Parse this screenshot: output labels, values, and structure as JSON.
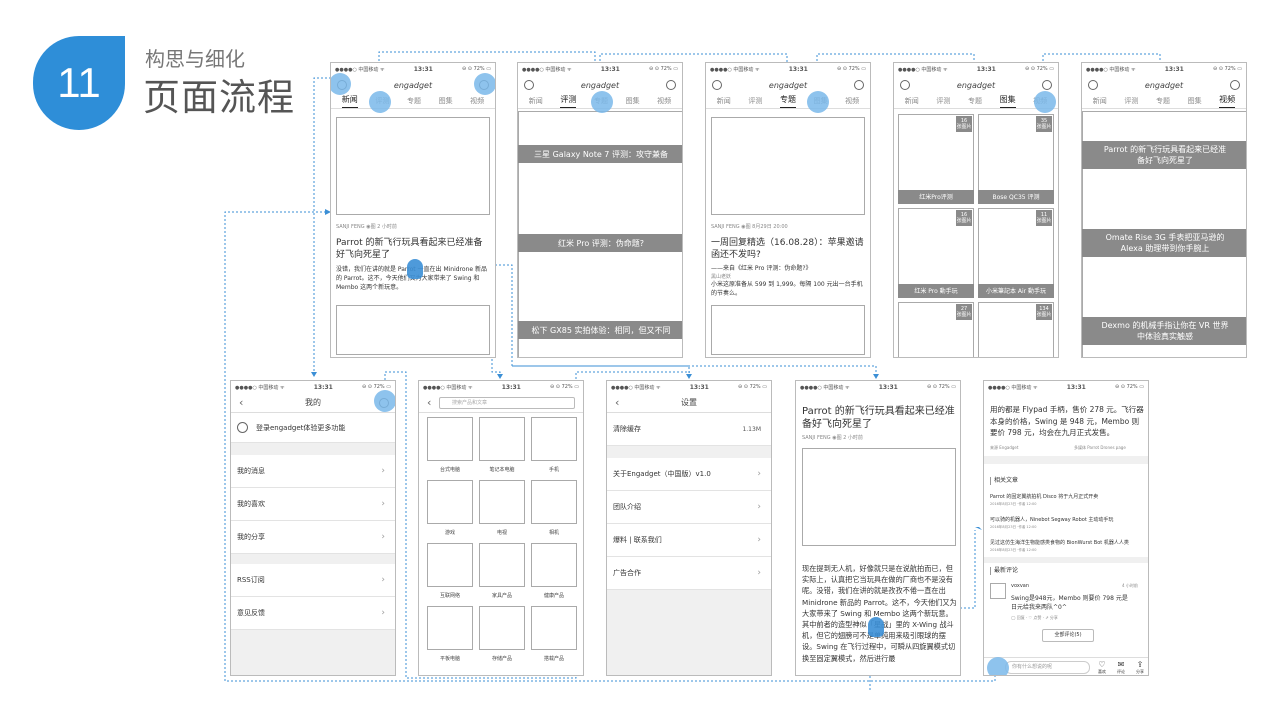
{
  "slide": {
    "number": "11",
    "subtitle": "构思与细化",
    "title": "页面流程"
  },
  "common": {
    "carrier": "●●●●○ 中国移动 ᯤ",
    "time": "13:31",
    "battery": "⊖ ⊙ 72% ▭",
    "logo": "engadget"
  },
  "tabs": [
    "新闻",
    "评测",
    "专题",
    "图集",
    "视频"
  ],
  "news": {
    "meta": "SANJI FENG  ◉图 2 小时前",
    "headline": "Parrot 的新飞行玩具看起来已经准备好飞向死星了",
    "body": "没错，我们在讲的就是 Parrot 一直在出 Minidrone 新品的 Parrot。这不，今天他们又为大家带来了 Swing 和 Membo 这两个新玩意。"
  },
  "review": [
    "三星 Galaxy Note 7 评测：攻守兼备",
    "红米 Pro 评测：伪命题?",
    "松下 GX85 实拍体验：相同，但又不同"
  ],
  "topic": {
    "meta": "SANJI FENG  ◉图 8月29日 20:00",
    "headline": "一周回复精选（16.08.28）：苹果邀请函还不发吗?",
    "quote": "——来自《红米 Pro 评测：伪命题?》",
    "user": "黑山老妖",
    "body": "小米这原准备从 599 到 1,999。每隔 100 元出一台手机的节奏么。"
  },
  "gallery": [
    {
      "cap": "红米Pro评测",
      "n": "16"
    },
    {
      "cap": "Bose QC35 评测",
      "n": "35"
    },
    {
      "cap": "红米 Pro 動手玩",
      "n": "16"
    },
    {
      "cap": "小米筆記本 Air 動手玩",
      "n": "11"
    }
  ],
  "gallery_more": [
    "27",
    "134"
  ],
  "gallery_unit": "张图片",
  "video": [
    "Parrot 的新飞行玩具看起来已经准备好飞向死星了",
    "Omate Rise 3G 手表把亚马逊的Alexa 助理带到你手腕上",
    "Dexmo 的机械手指让你在 VR 世界中体验真实触感"
  ],
  "mine": {
    "title": "我的",
    "login": "登录engadget体验更多功能",
    "items": [
      "我的消息",
      "我的喜欢",
      "我的分享",
      "RSS订阅",
      "意见反馈"
    ]
  },
  "search": {
    "placeholder": "搜索产品和文章",
    "cats": [
      "台式电脑",
      "笔记本电脑",
      "手机",
      "游戏",
      "电视",
      "相机",
      "互联网络",
      "家具产品",
      "健康产品",
      "平板电脑",
      "存储产品",
      "搭载产品"
    ]
  },
  "settings": {
    "title": "设置",
    "items": [
      {
        "l": "清除缓存",
        "v": "1.13M"
      },
      {
        "l": "关于Engadget（中国版）v1.0",
        "v": ""
      },
      {
        "l": "团队介绍",
        "v": ""
      },
      {
        "l": "爆料 | 联系我们",
        "v": ""
      },
      {
        "l": "广告合作",
        "v": ""
      }
    ]
  },
  "article": {
    "headline": "Parrot 的新飞行玩具看起来已经准备好飞向死星了",
    "meta": "SANJI FENG  ◉图  2 小时前",
    "body": "现在提到无人机，好像就只是在说航拍而已，但实际上，认真把它当玩具在做的厂商也不是没有呢。没错，我们在讲的就是孜孜不倦一直在出 Minidrone 新品的 Parrot。这不，今天他们又为大家带来了 Swing 和 Membo 这两个新玩意。其中前者的造型神似「星战」里的 X-Wing 战斗机，但它的翅膀可不是单纯用来吸引眼球的摆设。Swing 在飞行过程中，可瞬从四旋翼模式切换至固定翼模式，然后进行最"
  },
  "comments": {
    "top": "用的都是 Flypad 手柄，售价 278 元。飞行器本身的价格，Swing 是 948 元，Membo 则要价 798 元，均会在九月正式发售。",
    "src1": "来源 Engadget",
    "src2": "多媒体 Parrot Drones page",
    "related_title": "相关文章",
    "related": [
      "Parrot 的固定翼航拍机 Disco 将于九月正式开卖",
      "可以骑的机器人，Ninebot Segway Robot 主动动手玩",
      "见过这仿生海洋生物能感类食物的 BionWurst Bot 机器人人类"
    ],
    "related_meta": "2016年8月23日 ·作者 12:00",
    "latest_title": "最新评论",
    "user": "voxvan",
    "time": "4 小时前",
    "comment": "Swing是948元，Membo 则要价 798 元是日元给我来两队^0^",
    "actions": "◯ 回复 · ♡ 点赞 · ⇗ 分享",
    "all": "全部评论(5)",
    "input": "你有什么想说的呢",
    "bar": [
      "喜欢",
      "评论",
      "分享"
    ]
  }
}
